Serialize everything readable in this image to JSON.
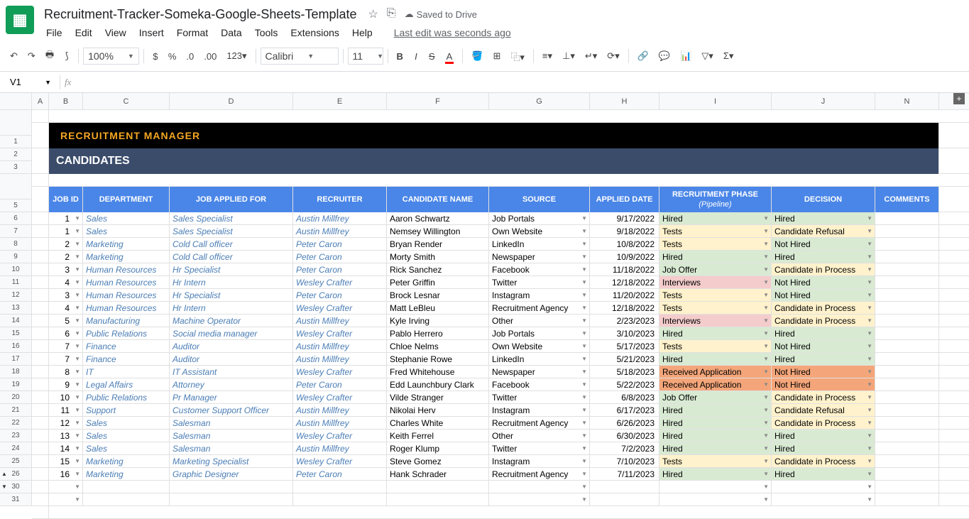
{
  "doc": {
    "title": "Recruitment-Tracker-Someka-Google-Sheets-Template",
    "saved": "Saved to Drive",
    "last_edit": "Last edit was seconds ago"
  },
  "menus": [
    "File",
    "Edit",
    "View",
    "Insert",
    "Format",
    "Data",
    "Tools",
    "Extensions",
    "Help"
  ],
  "toolbar": {
    "zoom": "100%",
    "font": "Calibri",
    "size": "11"
  },
  "name_box": "V1",
  "cols": [
    {
      "l": "A",
      "w": 24
    },
    {
      "l": "B",
      "w": 48
    },
    {
      "l": "C",
      "w": 122
    },
    {
      "l": "D",
      "w": 174
    },
    {
      "l": "E",
      "w": 132
    },
    {
      "l": "F",
      "w": 144
    },
    {
      "l": "G",
      "w": 142
    },
    {
      "l": "H",
      "w": 98
    },
    {
      "l": "I",
      "w": 158
    },
    {
      "l": "J",
      "w": 146
    },
    {
      "l": "N",
      "w": 90
    }
  ],
  "row_nums": [
    "",
    "1",
    "2",
    "3",
    "",
    "5",
    "6",
    "7",
    "8",
    "9",
    "10",
    "11",
    "12",
    "13",
    "14",
    "15",
    "16",
    "17",
    "18",
    "19",
    "20",
    "21",
    "22",
    "23",
    "24",
    "25",
    "26",
    "30",
    "31"
  ],
  "banner1": "RECRUITMENT MANAGER",
  "banner2": "CANDIDATES",
  "headers": [
    "JOB ID",
    "DEPARTMENT",
    "JOB APPLIED FOR",
    "RECRUITER",
    "CANDIDATE NAME",
    "SOURCE",
    "APPLIED DATE",
    "RECRUITMENT PHASE",
    "DECISION",
    "COMMENTS"
  ],
  "pipeline_sub": "(Pipeline)",
  "rows": [
    {
      "id": "1",
      "dept": "Sales",
      "job": "Sales Specialist",
      "rec": "Austin Millfrey",
      "name": "Aaron Schwartz",
      "src": "Job Portals",
      "date": "9/17/2022",
      "phase": "Hired",
      "phc": "ph-hired",
      "dec": "Hired",
      "dc": "dec-hired"
    },
    {
      "id": "1",
      "dept": "Sales",
      "job": "Sales Specialist",
      "rec": "Austin Millfrey",
      "name": "Nemsey Willington",
      "src": "Own Website",
      "date": "9/18/2022",
      "phase": "Tests",
      "phc": "ph-tests",
      "dec": "Candidate Refusal",
      "dc": "dec-refuse"
    },
    {
      "id": "2",
      "dept": "Marketing",
      "job": "Cold Call officer",
      "rec": "Peter Caron",
      "name": "Bryan Render",
      "src": "LinkedIn",
      "date": "10/8/2022",
      "phase": "Tests",
      "phc": "ph-tests",
      "dec": "Not Hired",
      "dc": "dec-nothired"
    },
    {
      "id": "2",
      "dept": "Marketing",
      "job": "Cold Call officer",
      "rec": "Peter Caron",
      "name": "Morty Smith",
      "src": "Newspaper",
      "date": "10/9/2022",
      "phase": "Hired",
      "phc": "ph-hired",
      "dec": "Hired",
      "dc": "dec-hired"
    },
    {
      "id": "3",
      "dept": "Human Resources",
      "job": "Hr Specialist",
      "rec": "Peter Caron",
      "name": "Rick Sanchez",
      "src": "Facebook",
      "date": "11/18/2022",
      "phase": "Job Offer",
      "phc": "ph-offer",
      "dec": "Candidate in Process",
      "dc": "dec-proc"
    },
    {
      "id": "4",
      "dept": "Human Resources",
      "job": "Hr Intern",
      "rec": "Wesley Crafter",
      "name": "Peter Griffin",
      "src": "Twitter",
      "date": "12/18/2022",
      "phase": "Interviews",
      "phc": "ph-intv",
      "dec": "Not Hired",
      "dc": "dec-nothired"
    },
    {
      "id": "3",
      "dept": "Human Resources",
      "job": "Hr Specialist",
      "rec": "Peter Caron",
      "name": "Brock Lesnar",
      "src": "Instagram",
      "date": "11/20/2022",
      "phase": "Tests",
      "phc": "ph-tests",
      "dec": "Not Hired",
      "dc": "dec-nothired"
    },
    {
      "id": "4",
      "dept": "Human Resources",
      "job": "Hr Intern",
      "rec": "Wesley Crafter",
      "name": "Matt LeBleu",
      "src": "Recruitment Agency",
      "date": "12/18/2022",
      "phase": "Tests",
      "phc": "ph-tests",
      "dec": "Candidate in Process",
      "dc": "dec-proc"
    },
    {
      "id": "5",
      "dept": "Manufacturing",
      "job": "Machine Operator",
      "rec": "Austin Millfrey",
      "name": "Kyle Irving",
      "src": "Other",
      "date": "2/23/2023",
      "phase": "Interviews",
      "phc": "ph-intv",
      "dec": "Candidate in Process",
      "dc": "dec-proc"
    },
    {
      "id": "6",
      "dept": "Public Relations",
      "job": "Social media manager",
      "rec": "Wesley Crafter",
      "name": "Pablo Herrero",
      "src": "Job Portals",
      "date": "3/10/2023",
      "phase": "Hired",
      "phc": "ph-hired",
      "dec": "Hired",
      "dc": "dec-hired"
    },
    {
      "id": "7",
      "dept": "Finance",
      "job": "Auditor",
      "rec": "Austin Millfrey",
      "name": "Chloe Nelms",
      "src": "Own Website",
      "date": "5/17/2023",
      "phase": "Tests",
      "phc": "ph-tests",
      "dec": "Not Hired",
      "dc": "dec-nothired"
    },
    {
      "id": "7",
      "dept": "Finance",
      "job": "Auditor",
      "rec": "Austin Millfrey",
      "name": "Stephanie Rowe",
      "src": "LinkedIn",
      "date": "5/21/2023",
      "phase": "Hired",
      "phc": "ph-hired",
      "dec": "Hired",
      "dc": "dec-hired"
    },
    {
      "id": "8",
      "dept": "IT",
      "job": "IT Assistant",
      "rec": "Wesley Crafter",
      "name": "Fred Whitehouse",
      "src": "Newspaper",
      "date": "5/18/2023",
      "phase": "Received Application",
      "phc": "ph-recv",
      "dec": "Not Hired",
      "dc": "dec-nh-orange"
    },
    {
      "id": "9",
      "dept": "Legal Affairs",
      "job": "Attorney",
      "rec": "Peter Caron",
      "name": "Edd Launchbury Clark",
      "src": "Facebook",
      "date": "5/22/2023",
      "phase": "Received Application",
      "phc": "ph-recv",
      "dec": "Not Hired",
      "dc": "dec-nh-orange"
    },
    {
      "id": "10",
      "dept": "Public Relations",
      "job": "Pr Manager",
      "rec": "Wesley Crafter",
      "name": "Vilde Stranger",
      "src": "Twitter",
      "date": "6/8/2023",
      "phase": "Job Offer",
      "phc": "ph-offer",
      "dec": "Candidate in Process",
      "dc": "dec-proc"
    },
    {
      "id": "11",
      "dept": "Support",
      "job": "Customer Support Officer",
      "rec": "Austin Millfrey",
      "name": "Nikolai Herv",
      "src": "Instagram",
      "date": "6/17/2023",
      "phase": "Hired",
      "phc": "ph-hired",
      "dec": "Candidate Refusal",
      "dc": "dec-refuse"
    },
    {
      "id": "12",
      "dept": "Sales",
      "job": "Salesman",
      "rec": "Austin Millfrey",
      "name": "Charles White",
      "src": "Recruitment Agency",
      "date": "6/26/2023",
      "phase": "Hired",
      "phc": "ph-hired",
      "dec": "Candidate in Process",
      "dc": "dec-proc"
    },
    {
      "id": "13",
      "dept": "Sales",
      "job": "Salesman",
      "rec": "Wesley Crafter",
      "name": "Keith Ferrel",
      "src": "Other",
      "date": "6/30/2023",
      "phase": "Hired",
      "phc": "ph-hired",
      "dec": "Hired",
      "dc": "dec-hired"
    },
    {
      "id": "14",
      "dept": "Sales",
      "job": "Salesman",
      "rec": "Austin Millfrey",
      "name": "Roger Klump",
      "src": "Twitter",
      "date": "7/2/2023",
      "phase": "Hired",
      "phc": "ph-hired",
      "dec": "Hired",
      "dc": "dec-hired"
    },
    {
      "id": "15",
      "dept": "Marketing",
      "job": "Marketing Specialist",
      "rec": "Wesley Crafter",
      "name": "Steve Gomez",
      "src": "Instagram",
      "date": "7/10/2023",
      "phase": "Tests",
      "phc": "ph-tests",
      "dec": "Candidate in Process",
      "dc": "dec-proc"
    },
    {
      "id": "16",
      "dept": "Marketing",
      "job": "Graphic Designer",
      "rec": "Peter Caron",
      "name": "Hank Schrader",
      "src": "Recruitment Agency",
      "date": "7/11/2023",
      "phase": "Hired",
      "phc": "ph-hired",
      "dec": "Hired",
      "dc": "dec-hired"
    }
  ]
}
